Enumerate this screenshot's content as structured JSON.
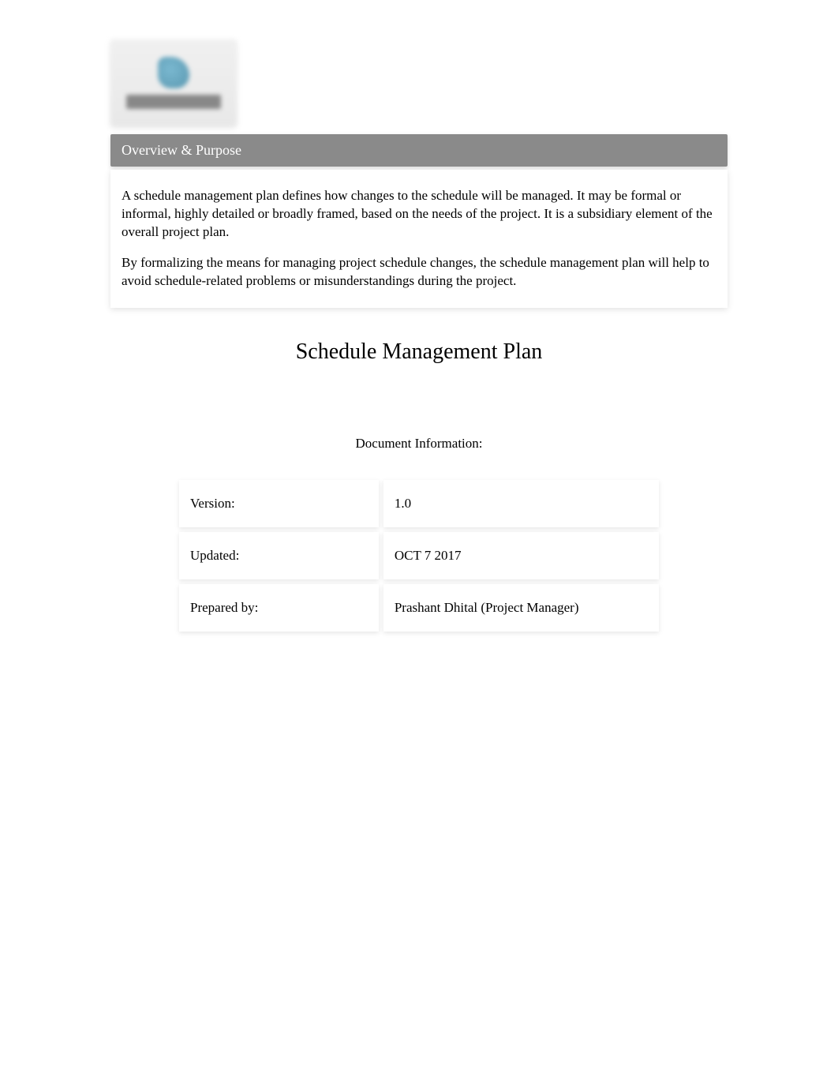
{
  "section": {
    "header": "Overview & Purpose",
    "paragraph1": "A schedule management plan defines how changes to the schedule will be managed. It may be formal or informal, highly detailed or broadly framed, based on the needs of the project. It is a subsidiary element of the overall project plan.",
    "paragraph2": "By formalizing the means for managing project schedule changes, the schedule management plan will help to avoid schedule-related problems or misunderstandings during the project."
  },
  "title": "Schedule Management Plan",
  "docInfoLabel": "Document Information:",
  "infoTable": {
    "rows": [
      {
        "label": "Version:",
        "value": "1.0"
      },
      {
        "label": "Updated:",
        "value": "OCT 7 2017"
      },
      {
        "label": "Prepared by:",
        "value": "Prashant Dhital (Project Manager)"
      }
    ]
  }
}
